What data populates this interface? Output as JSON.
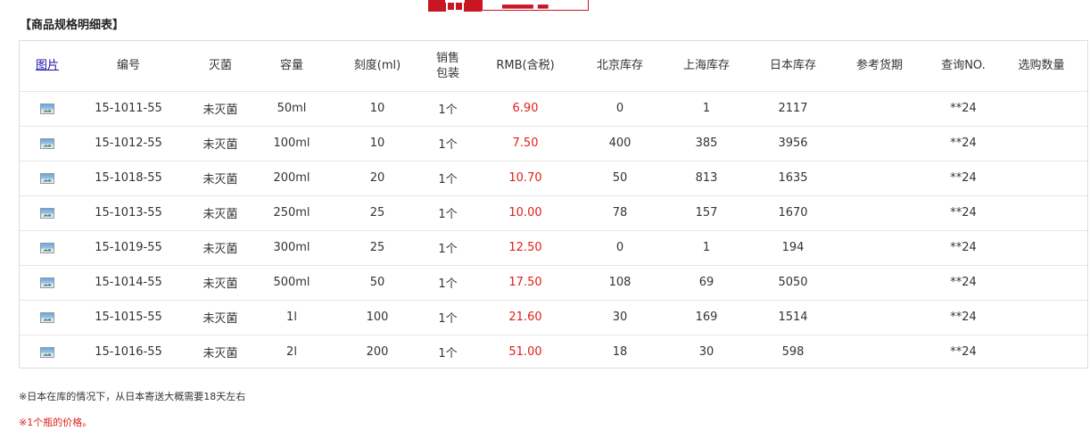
{
  "section_title": "【商品规格明细表】",
  "table": {
    "headers": {
      "image": "图片",
      "code": "编号",
      "sterile": "灭菌",
      "capacity": "容量",
      "scale": "刻度(ml)",
      "pack_line1": "销售",
      "pack_line2": "包装",
      "price": "RMB(含税)",
      "stock_beijing": "北京库存",
      "stock_shanghai": "上海库存",
      "stock_japan": "日本库存",
      "ref_delivery": "参考货期",
      "query_no": "查询NO.",
      "quantity": "选购数量"
    },
    "rows": [
      {
        "code": "15-1011-55",
        "sterile": "未灭菌",
        "capacity": "50ml",
        "scale": "10",
        "pack": "1个",
        "price": "6.90",
        "stock_beijing": "0",
        "stock_shanghai": "1",
        "stock_japan": "2117",
        "ref_delivery": "",
        "query_no": "**24",
        "quantity": ""
      },
      {
        "code": "15-1012-55",
        "sterile": "未灭菌",
        "capacity": "100ml",
        "scale": "10",
        "pack": "1个",
        "price": "7.50",
        "stock_beijing": "400",
        "stock_shanghai": "385",
        "stock_japan": "3956",
        "ref_delivery": "",
        "query_no": "**24",
        "quantity": ""
      },
      {
        "code": "15-1018-55",
        "sterile": "未灭菌",
        "capacity": "200ml",
        "scale": "20",
        "pack": "1个",
        "price": "10.70",
        "stock_beijing": "50",
        "stock_shanghai": "813",
        "stock_japan": "1635",
        "ref_delivery": "",
        "query_no": "**24",
        "quantity": ""
      },
      {
        "code": "15-1013-55",
        "sterile": "未灭菌",
        "capacity": "250ml",
        "scale": "25",
        "pack": "1个",
        "price": "10.00",
        "stock_beijing": "78",
        "stock_shanghai": "157",
        "stock_japan": "1670",
        "ref_delivery": "",
        "query_no": "**24",
        "quantity": ""
      },
      {
        "code": "15-1019-55",
        "sterile": "未灭菌",
        "capacity": "300ml",
        "scale": "25",
        "pack": "1个",
        "price": "12.50",
        "stock_beijing": "0",
        "stock_shanghai": "1",
        "stock_japan": "194",
        "ref_delivery": "",
        "query_no": "**24",
        "quantity": ""
      },
      {
        "code": "15-1014-55",
        "sterile": "未灭菌",
        "capacity": "500ml",
        "scale": "50",
        "pack": "1个",
        "price": "17.50",
        "stock_beijing": "108",
        "stock_shanghai": "69",
        "stock_japan": "5050",
        "ref_delivery": "",
        "query_no": "**24",
        "quantity": ""
      },
      {
        "code": "15-1015-55",
        "sterile": "未灭菌",
        "capacity": "1l",
        "scale": "100",
        "pack": "1个",
        "price": "21.60",
        "stock_beijing": "30",
        "stock_shanghai": "169",
        "stock_japan": "1514",
        "ref_delivery": "",
        "query_no": "**24",
        "quantity": ""
      },
      {
        "code": "15-1016-55",
        "sterile": "未灭菌",
        "capacity": "2l",
        "scale": "200",
        "pack": "1个",
        "price": "51.00",
        "stock_beijing": "18",
        "stock_shanghai": "30",
        "stock_japan": "598",
        "ref_delivery": "",
        "query_no": "**24",
        "quantity": ""
      }
    ]
  },
  "notes": {
    "delivery": "※日本在库的情况下，从日本寄送大概需要18天左右",
    "price": "※1个瓶的价格。"
  },
  "icons": {
    "banner": "gift-box-icon",
    "row_image": "product-thumbnail-icon"
  },
  "colors": {
    "brand_red": "#c81623",
    "price_red": "#e0201b",
    "link_blue": "#1a0dab"
  }
}
